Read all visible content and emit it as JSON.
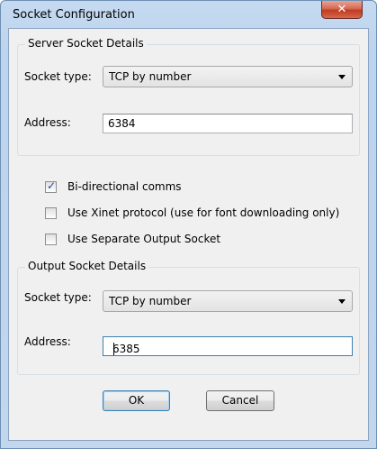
{
  "window": {
    "title": "Socket Configuration",
    "close_glyph": "✕"
  },
  "server": {
    "legend": "Server Socket Details",
    "socket_type_label": "Socket type:",
    "socket_type_value": "TCP by number",
    "address_label": "Address:",
    "address_value": "6384"
  },
  "options": [
    {
      "label": "Bi-directional comms",
      "checked": true
    },
    {
      "label": "Use Xinet protocol (use for font downloading only)",
      "checked": false
    },
    {
      "label": "Use Separate Output Socket",
      "checked": false
    }
  ],
  "output": {
    "legend": "Output Socket Details",
    "socket_type_label": "Socket type:",
    "socket_type_value": "TCP by number",
    "address_label": "Address:",
    "address_value": "6385"
  },
  "buttons": {
    "ok": "OK",
    "cancel": "Cancel"
  }
}
